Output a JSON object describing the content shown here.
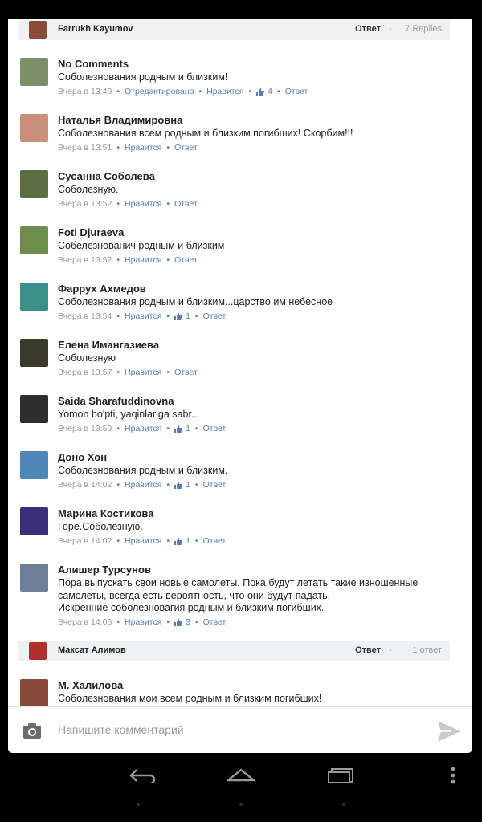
{
  "thread_header": {
    "author": "Farrukh Kayumov",
    "reply_label": "Ответ",
    "replies": "7 Replies"
  },
  "comments": [
    {
      "name": "No Comments",
      "text": "Соболезнования родным и  близким!",
      "time": "Вчера в 13:49",
      "edited": "Отредактировано",
      "like_label": "Нравится",
      "likes": "4",
      "reply_label": "Ответ",
      "avatar_color": "#7a8f6a"
    },
    {
      "name": "Наталья Владимировна",
      "text": "Соболезнования всем родным и близким погибших! Скорбим!!!",
      "time": "Вчера в 13:51",
      "like_label": "Нравится",
      "likes": "",
      "reply_label": "Ответ",
      "avatar_color": "#c98f7a"
    },
    {
      "name": "Сусанна Соболева",
      "text": "Соболезную.",
      "time": "Вчера в 13:52",
      "like_label": "Нравится",
      "likes": "",
      "reply_label": "Ответ",
      "avatar_color": "#5a6f3f"
    },
    {
      "name": "Foti Djuraeva",
      "text": "Собелезнованич родным и близким",
      "time": "Вчера в 13:52",
      "like_label": "Нравится",
      "likes": "",
      "reply_label": "Ответ",
      "avatar_color": "#6f8e4e"
    },
    {
      "name": "Фаррух Ахмедов",
      "text": "Соболезнования родным и близким...царство им небесное",
      "time": "Вчера в 13:54",
      "like_label": "Нравится",
      "likes": "1",
      "reply_label": "Ответ",
      "avatar_color": "#3b8f8a"
    },
    {
      "name": "Елена Имангазиева",
      "text": "Соболезную",
      "time": "Вчера в 13:57",
      "like_label": "Нравится",
      "likes": "",
      "reply_label": "Ответ",
      "avatar_color": "#3a3a2a"
    },
    {
      "name": "Saida Sharafuddinovna",
      "text": "Yomon bo'pti, yaqinlariga sabr...",
      "time": "Вчера в 13:59",
      "like_label": "Нравится",
      "likes": "1",
      "reply_label": "Ответ",
      "avatar_color": "#2e2e2e"
    },
    {
      "name": "Доно Хон",
      "text": "Соболезнования родным и близким.",
      "time": "Вчера в 14:02",
      "like_label": "Нравится",
      "likes": "1",
      "reply_label": "Ответ",
      "avatar_color": "#4f86b8"
    },
    {
      "name": "Марина Костикова",
      "text": "Горе.Соболезную.",
      "time": "Вчера в 14:02",
      "like_label": "Нравится",
      "likes": "1",
      "reply_label": "Ответ",
      "avatar_color": "#3c2f7a"
    },
    {
      "name": "Алишер Турсунов",
      "text": "Пора выпускать свои новые самолеты. Пока будут летать такие изношенные самолеты, всегда есть вероятность, что они будут падать.\nИскренние соболезновагия родным и близким погибших.",
      "time": "Вчера в 14:06",
      "like_label": "Нравится",
      "likes": "3",
      "reply_label": "Ответ",
      "avatar_color": "#6f7f99"
    }
  ],
  "sub_thread": {
    "author": "Максат Алимов",
    "reply_label": "Ответ",
    "replies": "1 ответ"
  },
  "last_comment": {
    "name": "М. Халилова",
    "text": "Соболезнования мои всем родным и близким погибших!",
    "avatar_color": "#8a4a3a"
  },
  "composer": {
    "placeholder": "Напишите комментарий"
  },
  "colors": {
    "link": "#5b7fa6",
    "muted": "#999999",
    "card": "#ffffff",
    "background": "#000000"
  },
  "icons": {
    "camera": "camera-icon",
    "send": "send-icon",
    "like": "thumbs-up-icon",
    "back": "back-icon",
    "home": "home-icon",
    "recents": "recents-icon",
    "menu": "more-vert-icon"
  }
}
